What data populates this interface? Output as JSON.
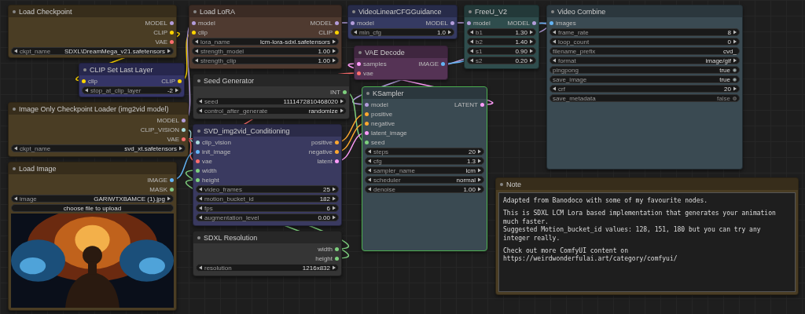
{
  "nodes": [
    {
      "kind": "node",
      "title": "Load Checkpoint",
      "color": "#4a3d24",
      "selected": false,
      "outputs": [
        {
          "name": "MODEL",
          "color": "#b39ddb"
        },
        {
          "name": "CLIP",
          "color": "#ffd500"
        },
        {
          "name": "VAE",
          "color": "#ff6e6e"
        }
      ],
      "widgets": [
        {
          "kind": "combo",
          "label": "ckpt_name",
          "value": "SDXL\\DreamMega_v21.safetensors"
        }
      ]
    },
    {
      "kind": "node",
      "title": "CLIP Set Last Layer",
      "color": "#353567",
      "selected": false,
      "inputs": [
        {
          "name": "clip",
          "color": "#ffd500"
        }
      ],
      "outputs": [
        {
          "name": "CLIP",
          "color": "#ffd500"
        }
      ],
      "widgets": [
        {
          "kind": "number",
          "label": "stop_at_clip_layer",
          "value": "-2"
        }
      ]
    },
    {
      "kind": "node",
      "title": "Load LoRA",
      "color": "#4f3a30",
      "selected": false,
      "inputs": [
        {
          "name": "model",
          "color": "#b39ddb"
        },
        {
          "name": "clip",
          "color": "#ffd500"
        }
      ],
      "outputs": [
        {
          "name": "MODEL",
          "color": "#b39ddb"
        },
        {
          "name": "CLIP",
          "color": "#ffd500"
        }
      ],
      "widgets": [
        {
          "kind": "combo",
          "label": "lora_name",
          "value": "lcm-lora-sdxl.safetensors"
        },
        {
          "kind": "number",
          "label": "strength_model",
          "value": "1.00"
        },
        {
          "kind": "number",
          "label": "strength_clip",
          "value": "1.00"
        }
      ]
    },
    {
      "kind": "node",
      "title": "VideoLinearCFGGuidance",
      "color": "#353a62",
      "selected": false,
      "inputs": [
        {
          "name": "model",
          "color": "#b39ddb"
        }
      ],
      "outputs": [
        {
          "name": "MODEL",
          "color": "#b39ddb"
        }
      ],
      "widgets": [
        {
          "kind": "number",
          "label": "min_cfg",
          "value": "1.0"
        }
      ]
    },
    {
      "kind": "node",
      "title": "FreeU_V2",
      "color": "#2f4d4d",
      "selected": false,
      "inputs": [
        {
          "name": "model",
          "color": "#b39ddb"
        }
      ],
      "outputs": [
        {
          "name": "MODEL",
          "color": "#b39ddb"
        }
      ],
      "widgets": [
        {
          "kind": "number",
          "label": "b1",
          "value": "1.30"
        },
        {
          "kind": "number",
          "label": "b2",
          "value": "1.40"
        },
        {
          "kind": "number",
          "label": "s1",
          "value": "0.90"
        },
        {
          "kind": "number",
          "label": "s2",
          "value": "0.20"
        }
      ]
    },
    {
      "kind": "node",
      "title": "Video Combine",
      "color": "#3a4a52",
      "selected": false,
      "inputs": [
        {
          "name": "images",
          "color": "#64b5f6"
        }
      ],
      "widgets": [
        {
          "kind": "number",
          "label": "frame_rate",
          "value": "8"
        },
        {
          "kind": "number",
          "label": "loop_count",
          "value": "0"
        },
        {
          "kind": "text",
          "label": "filename_prefix",
          "value": "cvd_"
        },
        {
          "kind": "combo",
          "label": "format",
          "value": "image/gif"
        },
        {
          "kind": "toggle",
          "label": "pingpong",
          "value": "true",
          "on": true
        },
        {
          "kind": "toggle",
          "label": "save_image",
          "value": "true",
          "on": true
        },
        {
          "kind": "number",
          "label": "crf",
          "value": "20"
        },
        {
          "kind": "toggle",
          "label": "save_metadata",
          "value": "false",
          "on": false
        }
      ]
    },
    {
      "kind": "node",
      "title": "VAE Decode",
      "color": "#553355",
      "selected": false,
      "inputs": [
        {
          "name": "samples",
          "color": "#ff9cf9"
        },
        {
          "name": "vae",
          "color": "#ff6e6e"
        }
      ],
      "outputs": [
        {
          "name": "IMAGE",
          "color": "#64b5f6"
        }
      ]
    },
    {
      "kind": "node",
      "title": "Image Only Checkpoint Loader (img2vid model)",
      "color": "#4a3d24",
      "selected": false,
      "outputs": [
        {
          "name": "MODEL",
          "color": "#b39ddb"
        },
        {
          "name": "CLIP_VISION",
          "color": "#a8dadc"
        },
        {
          "name": "VAE",
          "color": "#ff6e6e"
        }
      ],
      "widgets": [
        {
          "kind": "combo",
          "label": "ckpt_name",
          "value": "svd_xt.safetensors"
        }
      ]
    },
    {
      "kind": "node",
      "title": "Seed Generator",
      "color": "#353535",
      "selected": false,
      "outputs": [
        {
          "name": "INT",
          "color": "#7ed07e"
        }
      ],
      "widgets": [
        {
          "kind": "number",
          "label": "seed",
          "value": "1111472810468020"
        },
        {
          "kind": "combo",
          "label": "control_after_generate",
          "value": "randomize"
        }
      ]
    },
    {
      "kind": "node",
      "title": "KSampler",
      "color": "#3a4a52",
      "selected": true,
      "inputs": [
        {
          "name": "model",
          "color": "#b39ddb"
        },
        {
          "name": "positive",
          "color": "#ffa931"
        },
        {
          "name": "negative",
          "color": "#ffa931"
        },
        {
          "name": "latent_image",
          "color": "#ff9cf9"
        },
        {
          "name": "seed",
          "color": "#7ed07e"
        }
      ],
      "outputs": [
        {
          "name": "LATENT",
          "color": "#ff9cf9"
        }
      ],
      "widgets": [
        {
          "kind": "number",
          "label": "steps",
          "value": "20"
        },
        {
          "kind": "number",
          "label": "cfg",
          "value": "1.3"
        },
        {
          "kind": "combo",
          "label": "sampler_name",
          "value": "lcm"
        },
        {
          "kind": "combo",
          "label": "scheduler",
          "value": "normal"
        },
        {
          "kind": "number",
          "label": "denoise",
          "value": "1.00"
        }
      ]
    },
    {
      "kind": "node",
      "title": "Load Image",
      "color": "#4a3d24",
      "selected": false,
      "outputs": [
        {
          "name": "IMAGE",
          "color": "#64b5f6"
        },
        {
          "name": "MASK",
          "color": "#81c784"
        }
      ],
      "widgets": [
        {
          "kind": "combo",
          "label": "image",
          "value": "GARIWTXBAMCE (1).jpg"
        },
        {
          "kind": "button",
          "label": "choose file to upload"
        }
      ],
      "preview": {
        "kind": "picture"
      }
    },
    {
      "kind": "node",
      "title": "SVD_img2vid_Conditioning",
      "color": "#3a3a60",
      "selected": false,
      "inputs": [
        {
          "name": "clip_vision",
          "color": "#a8dadc"
        },
        {
          "name": "init_image",
          "color": "#64b5f6"
        },
        {
          "name": "vae",
          "color": "#ff6e6e"
        },
        {
          "name": "width",
          "color": "#7ed07e"
        },
        {
          "name": "height",
          "color": "#7ed07e"
        }
      ],
      "outputs": [
        {
          "name": "positive",
          "color": "#ffa931"
        },
        {
          "name": "negative",
          "color": "#ffa931"
        },
        {
          "name": "latent",
          "color": "#ff9cf9"
        }
      ],
      "widgets": [
        {
          "kind": "number",
          "label": "video_frames",
          "value": "25"
        },
        {
          "kind": "number",
          "label": "motion_bucket_id",
          "value": "182"
        },
        {
          "kind": "number",
          "label": "fps",
          "value": "6"
        },
        {
          "kind": "number",
          "label": "augmentation_level",
          "value": "0.00"
        }
      ]
    },
    {
      "kind": "node",
      "title": "SDXL Resolution",
      "color": "#353535",
      "selected": false,
      "outputs": [
        {
          "name": "width",
          "color": "#7ed07e"
        },
        {
          "name": "height",
          "color": "#7ed07e"
        }
      ],
      "widgets": [
        {
          "kind": "combo",
          "label": "resolution",
          "value": "1216x832"
        }
      ]
    },
    {
      "kind": "note",
      "title": "Note",
      "color": "#4a3d24",
      "selected": false,
      "paragraphs": [
        "Adapted from Banodoco with some of my favourite nodes.",
        "This is SDXL LCM Lora based implementation that generates your animation much faster.\nSuggested Motion_bucket_id values: 128, 151, 180 but you can try any integer really.",
        "Check out more ComfyUI content on https://weirdwonderfulai.art/category/comfyui/"
      ]
    }
  ]
}
